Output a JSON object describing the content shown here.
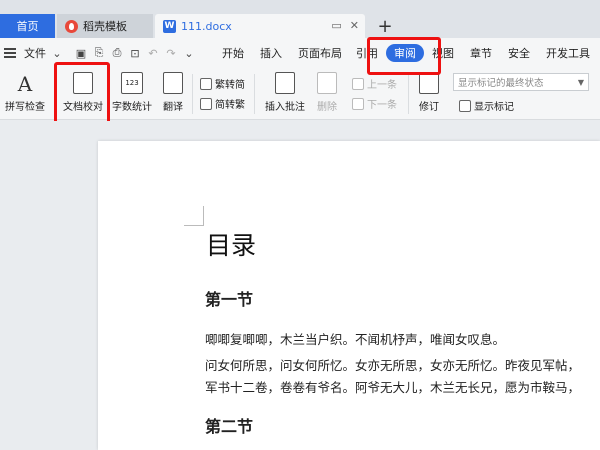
{
  "tabs": {
    "home": "首页",
    "template": "稻壳模板",
    "document": "111.docx",
    "new_tab": "+"
  },
  "menu": {
    "file": "文件",
    "tabs": [
      "开始",
      "插入",
      "页面布局",
      "引用",
      "审阅",
      "视图",
      "章节",
      "安全",
      "开发工具"
    ],
    "active_tab": "审阅"
  },
  "ribbon": {
    "spell_check": "拼写检查",
    "doc_proofread": "文档校对",
    "word_count": "字数统计",
    "translate": "翻译",
    "to_traditional": "繁转简",
    "to_simplified": "简转繁",
    "insert_comment": "插入批注",
    "delete": "删除",
    "prev": "上一条",
    "next": "下一条",
    "revise": "修订",
    "markup_state": "显示标记的最终状态",
    "show_markup": "显示标记",
    "word_count_icon_text": "123"
  },
  "document": {
    "title": "目录",
    "section1": "第一节",
    "para1": "唧唧复唧唧，木兰当户织。不闻机杼声，唯闻女叹息。",
    "para2": "问女何所思，问女何所忆。女亦无所思，女亦无所忆。昨夜见军帖，",
    "para3": "军书十二卷，卷卷有爷名。阿爷无大儿，木兰无长兄，愿为市鞍马，",
    "section2": "第二节"
  },
  "colors": {
    "accent": "#2e6de0",
    "highlight_box": "#ee1111"
  }
}
